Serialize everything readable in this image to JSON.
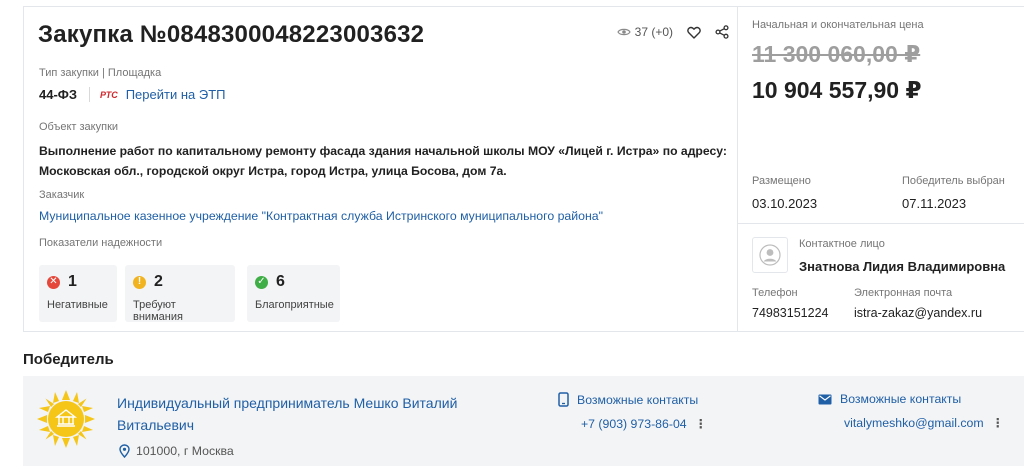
{
  "tender": {
    "title": "Закупка №0848300048223003632",
    "views": "37 (+0)",
    "type_label": "Тип закупки | Площадка",
    "law": "44-ФЗ",
    "platform_logo": "РТС",
    "etp_link": "Перейти на ЭТП",
    "object_label": "Объект закупки",
    "object_text": "Выполнение работ по капитальному ремонту фасада здания начальной школы МОУ «Лицей г. Истра» по адресу: Московская обл., городской округ Истра, город Истра, улица Босова, дом 7а.",
    "customer_label": "Заказчик",
    "customer": "Муниципальное казенное учреждение \"Контрактная служба Истринского муниципального района\"",
    "reliability_label": "Показатели надежности",
    "reliability": [
      {
        "count": "1",
        "caption": "Негативные",
        "color": "#e5483b",
        "symbol": "✕"
      },
      {
        "count": "2",
        "caption": "Требуют внимания",
        "color": "#f2b320",
        "symbol": "!"
      },
      {
        "count": "6",
        "caption": "Благоприятные",
        "color": "#3fae46",
        "symbol": "✓"
      }
    ]
  },
  "price": {
    "label": "Начальная и окончательная цена",
    "initial": "11 300 060,00 ₽",
    "final": "10 904 557,90 ₽"
  },
  "dates": {
    "placed_label": "Размещено",
    "placed": "03.10.2023",
    "winner_label": "Победитель выбран",
    "winner_date": "07.11.2023"
  },
  "contact": {
    "label": "Контактное лицо",
    "name": "Знатнова Лидия Владимировна",
    "phone_label": "Телефон",
    "phone": "74983151224",
    "email_label": "Электронная почта",
    "email": "istra-zakaz@yandex.ru"
  },
  "winner": {
    "heading": "Победитель",
    "name": "Индивидуальный предприниматель Мешко Виталий Витальевич",
    "address": "101000, г Москва",
    "phone_head": "Возможные контакты",
    "phone": "+7 (903) 973-86-04",
    "email_head": "Возможные контакты",
    "email": "vitalymeshko@gmail.com"
  },
  "icons": {
    "views": "eye-icon",
    "favorite": "heart-icon",
    "share": "share-icon",
    "avatar": "user-avatar-icon",
    "phone": "smartphone-icon",
    "email": "envelope-icon",
    "location": "location-pin-icon",
    "logo": "sun-emblem-logo"
  },
  "colors": {
    "link": "#1f5fa6",
    "muted": "#757575",
    "panel": "#f3f4f6",
    "logo": "#f5c518"
  }
}
